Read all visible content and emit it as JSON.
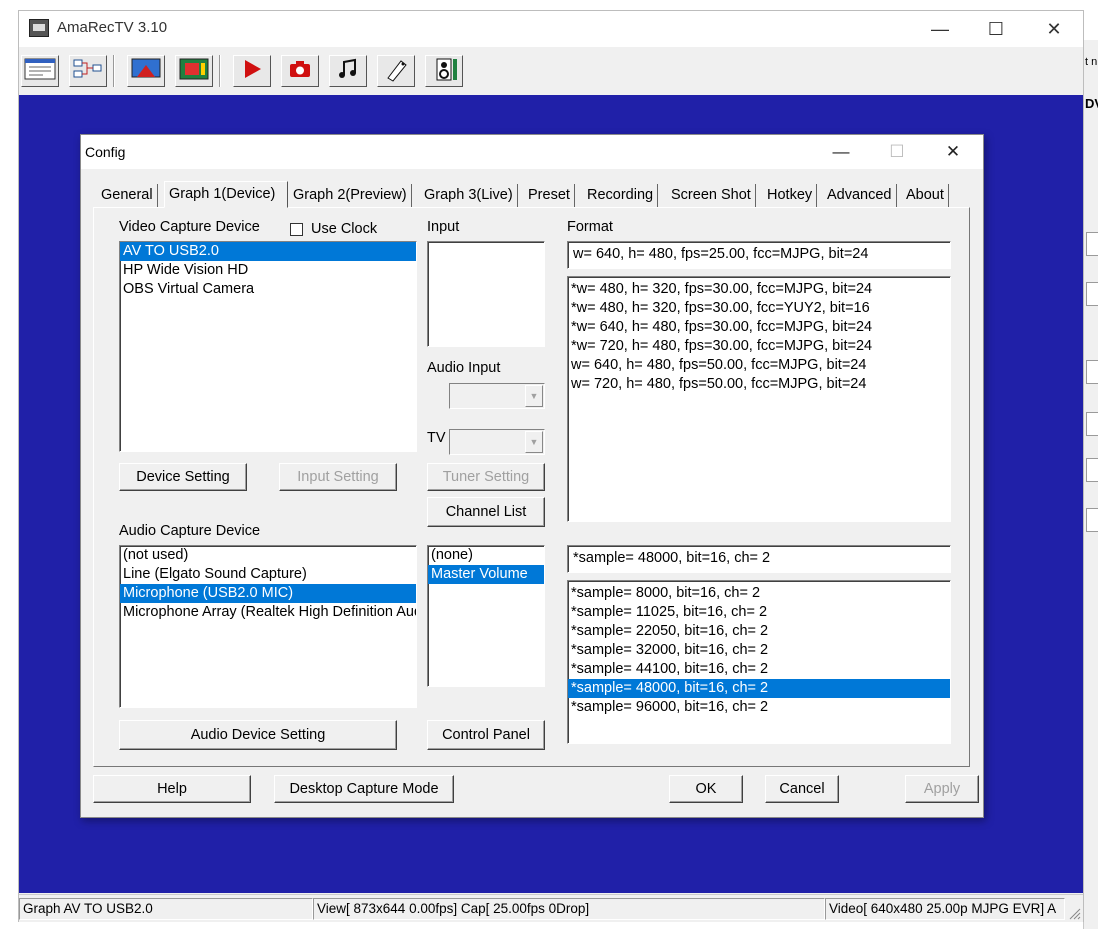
{
  "app": {
    "title": "AmaRecTV 3.10",
    "window_controls": {
      "minimize": "—",
      "maximize": "☐",
      "close": "✕"
    },
    "toolbar_icons": [
      "config-icon",
      "graph-icon",
      "preview-icon",
      "live-icon",
      "record-icon",
      "screenshot-icon",
      "music-icon",
      "hotkey-icon",
      "volume-icon"
    ]
  },
  "background_right": {
    "texts": [
      "t n",
      "DV"
    ]
  },
  "dialog": {
    "title": "Config",
    "controls": {
      "minimize": "—",
      "maximize": "☐",
      "close": "✕"
    },
    "tabs": [
      "General",
      "Graph 1(Device)",
      "Graph 2(Preview)",
      "Graph 3(Live)",
      "Preset",
      "Recording",
      "Screen Shot",
      "Hotkey",
      "Advanced",
      "About"
    ],
    "active_tab": "Graph 1(Device)",
    "video": {
      "label": "Video Capture Device",
      "use_clock_label": "Use Clock",
      "use_clock_checked": false,
      "devices": [
        "AV TO USB2.0",
        "HP Wide Vision HD",
        "OBS Virtual Camera"
      ],
      "selected_index": 0,
      "device_setting_button": "Device Setting",
      "input_setting_button": "Input Setting"
    },
    "input": {
      "label": "Input",
      "audio_input_label": "Audio Input",
      "tv_label": "TV",
      "tuner_setting_button": "Tuner Setting",
      "channel_list_button": "Channel List"
    },
    "format": {
      "label": "Format",
      "current": "w= 640, h= 480, fps=25.00,  fcc=MJPG, bit=24",
      "options": [
        "*w= 480, h= 320, fps=30.00,  fcc=MJPG, bit=24",
        "*w= 480, h= 320, fps=30.00,  fcc=YUY2, bit=16",
        "*w= 640, h= 480, fps=30.00,  fcc=MJPG, bit=24",
        "*w= 720, h= 480, fps=30.00,  fcc=MJPG, bit=24",
        "w= 640, h= 480, fps=50.00,  fcc=MJPG, bit=24",
        "w= 720, h= 480, fps=50.00,  fcc=MJPG, bit=24"
      ]
    },
    "audio": {
      "label": "Audio Capture Device",
      "devices": [
        "(not used)",
        "Line (Elgato Sound Capture)",
        "Microphone (USB2.0 MIC)",
        "Microphone Array (Realtek High Definition Audio)"
      ],
      "selected_index": 2,
      "mixer_items": [
        "(none)",
        "Master Volume"
      ],
      "mixer_selected_index": 1,
      "audio_device_setting_button": "Audio Device Setting",
      "control_panel_button": "Control Panel",
      "current_format": "*sample= 48000, bit=16, ch= 2",
      "formats": [
        "*sample=  8000, bit=16, ch= 2",
        "*sample= 11025, bit=16, ch= 2",
        "*sample= 22050, bit=16, ch= 2",
        "*sample= 32000, bit=16, ch= 2",
        "*sample= 44100, bit=16, ch= 2",
        "*sample= 48000, bit=16, ch= 2",
        "*sample= 96000, bit=16, ch= 2"
      ],
      "format_selected_index": 5
    },
    "buttons": {
      "help": "Help",
      "desktop_capture": "Desktop Capture Mode",
      "ok": "OK",
      "cancel": "Cancel",
      "apply": "Apply"
    }
  },
  "status": {
    "graph": "Graph AV TO USB2.0",
    "view": "View[ 873x644 0.00fps]  Cap[ 25.00fps 0Drop]",
    "video": "Video[ 640x480 25.00p MJPG EVR]  A"
  },
  "colors": {
    "viewport": "#2020a8",
    "selection": "#0078d7",
    "dialog_bg": "#f0f0f0"
  }
}
